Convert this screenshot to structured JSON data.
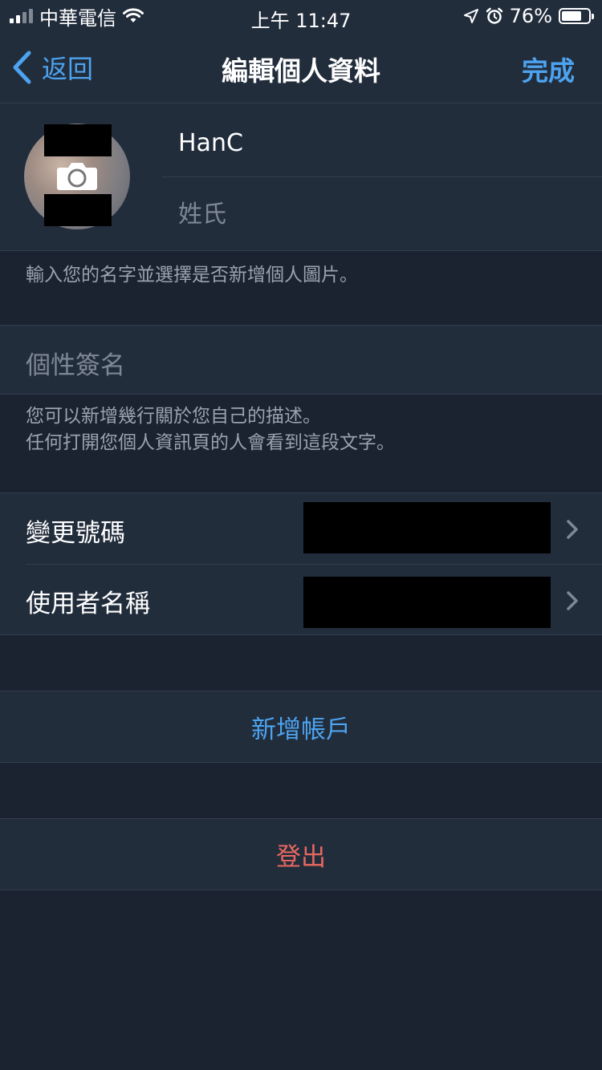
{
  "status_bar": {
    "carrier": "中華電信",
    "time": "上午 11:47",
    "battery_percent": "76%",
    "battery_level": 0.76,
    "signal_bars": 2,
    "icons": [
      "signal-icon",
      "wifi-icon",
      "location-arrow-icon",
      "alarm-icon",
      "battery-icon"
    ]
  },
  "nav": {
    "back_label": "返回",
    "title": "編輯個人資料",
    "done_label": "完成"
  },
  "profile": {
    "first_name": "HanC",
    "last_name_placeholder": "姓氏",
    "hint": "輸入您的名字並選擇是否新增個人圖片。"
  },
  "bio": {
    "placeholder": "個性簽名",
    "hint_line1": "您可以新增幾行關於您自己的描述。",
    "hint_line2": "任何打開您個人資訊頁的人會看到這段文字。"
  },
  "settings": {
    "items": [
      {
        "label": "變更號碼"
      },
      {
        "label": "使用者名稱"
      }
    ]
  },
  "actions": {
    "add_account": "新增帳戶",
    "logout": "登出"
  },
  "colors": {
    "background": "#1b2230",
    "section": "#222d3c",
    "separator": "#323d4d",
    "accent": "#4da3ef",
    "destructive": "#e8685f",
    "placeholder": "#7e8894",
    "hint": "#99a3ae"
  }
}
